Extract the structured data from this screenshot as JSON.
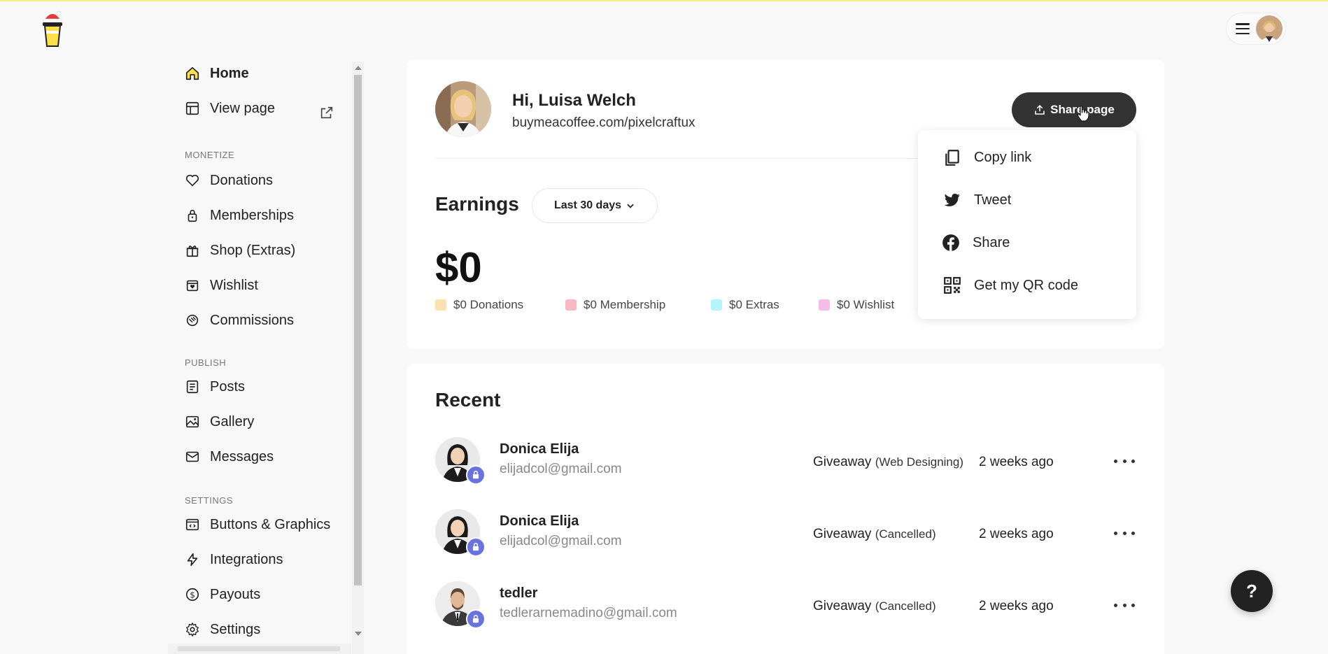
{
  "brand": {
    "logo_icon": "coffee-cup-santa-hat-icon"
  },
  "header": {
    "menu_icon": "hamburger-icon"
  },
  "sidebar": {
    "home": "Home",
    "view_page": "View page",
    "sections": {
      "monetize": "MONETIZE",
      "publish": "PUBLISH",
      "settings": "SETTINGS"
    },
    "monetize_items": [
      {
        "label": "Donations",
        "icon": "heart-icon"
      },
      {
        "label": "Memberships",
        "icon": "lock-icon"
      },
      {
        "label": "Shop (Extras)",
        "icon": "gift-icon"
      },
      {
        "label": "Wishlist",
        "icon": "wishlist-icon"
      },
      {
        "label": "Commissions",
        "icon": "handshake-icon"
      }
    ],
    "publish_items": [
      {
        "label": "Posts",
        "icon": "document-icon"
      },
      {
        "label": "Gallery",
        "icon": "image-icon"
      },
      {
        "label": "Messages",
        "icon": "mail-icon"
      }
    ],
    "settings_items": [
      {
        "label": "Buttons & Graphics",
        "icon": "code-window-icon"
      },
      {
        "label": "Integrations",
        "icon": "lightning-icon"
      },
      {
        "label": "Payouts",
        "icon": "dollar-circle-icon"
      },
      {
        "label": "Settings",
        "icon": "gear-icon"
      }
    ]
  },
  "profile": {
    "greeting": "Hi, Luisa Welch",
    "url": "buymeacoffee.com/pixelcraftux",
    "share_button": "Share page"
  },
  "share_menu": {
    "items": [
      {
        "label": "Copy link",
        "icon": "copy-icon"
      },
      {
        "label": "Tweet",
        "icon": "twitter-icon"
      },
      {
        "label": "Share",
        "icon": "facebook-icon"
      },
      {
        "label": "Get my QR code",
        "icon": "qr-code-icon"
      }
    ]
  },
  "earnings": {
    "title": "Earnings",
    "range": "Last 30 days",
    "total": "$0",
    "legend": [
      {
        "label": "$0 Donations",
        "color": "#fde1b0"
      },
      {
        "label": "$0 Membership",
        "color": "#f8b9c6"
      },
      {
        "label": "$0 Extras",
        "color": "#b4f4f8"
      },
      {
        "label": "$0 Wishlist",
        "color": "#f6bde8"
      }
    ]
  },
  "recent": {
    "title": "Recent",
    "rows": [
      {
        "name": "Donica Elija",
        "email": "elijadcol@gmail.com",
        "type": "Giveaway",
        "note": "(Web Designing)",
        "time": "2 weeks ago"
      },
      {
        "name": "Donica Elija",
        "email": "elijadcol@gmail.com",
        "type": "Giveaway",
        "note": "(Cancelled)",
        "time": "2 weeks ago"
      },
      {
        "name": "tedler",
        "email": "tedlerarnemadino@gmail.com",
        "type": "Giveaway",
        "note": "(Cancelled)",
        "time": "2 weeks ago"
      }
    ]
  },
  "help": {
    "label": "?"
  }
}
